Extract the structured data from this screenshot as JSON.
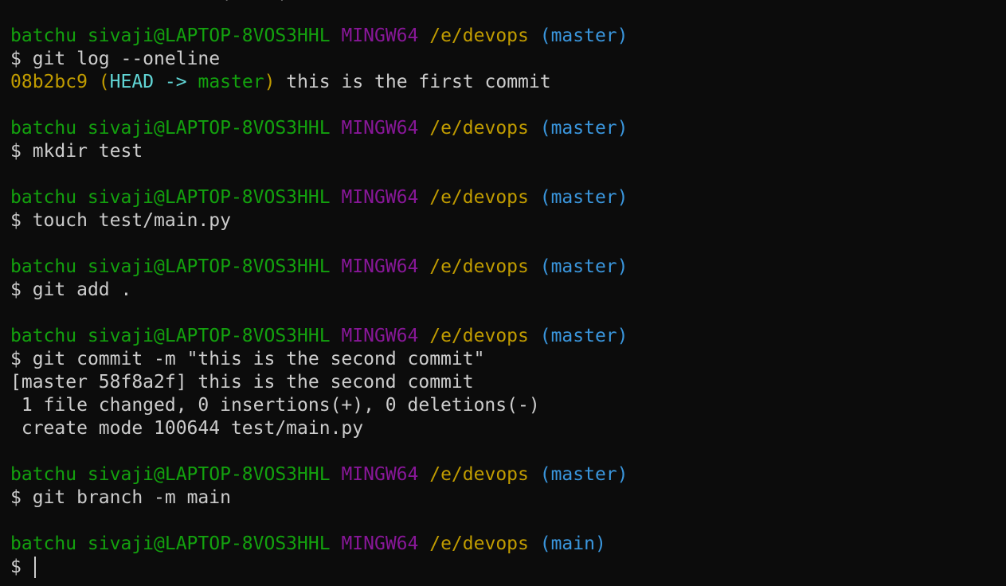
{
  "terminal": {
    "lines": [
      [
        {
          "t": "text",
          "v": "                   "
        },
        {
          "t": "text",
          "v": "ˎ    ˎ"
        }
      ],
      [],
      [
        {
          "t": "user",
          "v": "batchu sivaji@LAPTOP-8VOS3HHL"
        },
        {
          "t": "text",
          "v": " "
        },
        {
          "t": "system",
          "v": "MINGW64"
        },
        {
          "t": "text",
          "v": " "
        },
        {
          "t": "path",
          "v": "/e/devops"
        },
        {
          "t": "text",
          "v": " "
        },
        {
          "t": "branch",
          "v": "(master)"
        }
      ],
      [
        {
          "t": "dollar",
          "v": "$ "
        },
        {
          "t": "text",
          "v": "git log --oneline"
        }
      ],
      [
        {
          "t": "hash",
          "v": "08b2bc9"
        },
        {
          "t": "text",
          "v": " "
        },
        {
          "t": "paren",
          "v": "("
        },
        {
          "t": "head",
          "v": "HEAD"
        },
        {
          "t": "text",
          "v": " "
        },
        {
          "t": "arrow",
          "v": "->"
        },
        {
          "t": "text",
          "v": " "
        },
        {
          "t": "ref",
          "v": "master"
        },
        {
          "t": "paren",
          "v": ")"
        },
        {
          "t": "text",
          "v": " this is the first commit"
        }
      ],
      [],
      [
        {
          "t": "user",
          "v": "batchu sivaji@LAPTOP-8VOS3HHL"
        },
        {
          "t": "text",
          "v": " "
        },
        {
          "t": "system",
          "v": "MINGW64"
        },
        {
          "t": "text",
          "v": " "
        },
        {
          "t": "path",
          "v": "/e/devops"
        },
        {
          "t": "text",
          "v": " "
        },
        {
          "t": "branch",
          "v": "(master)"
        }
      ],
      [
        {
          "t": "dollar",
          "v": "$ "
        },
        {
          "t": "text",
          "v": "mkdir test"
        }
      ],
      [],
      [
        {
          "t": "user",
          "v": "batchu sivaji@LAPTOP-8VOS3HHL"
        },
        {
          "t": "text",
          "v": " "
        },
        {
          "t": "system",
          "v": "MINGW64"
        },
        {
          "t": "text",
          "v": " "
        },
        {
          "t": "path",
          "v": "/e/devops"
        },
        {
          "t": "text",
          "v": " "
        },
        {
          "t": "branch",
          "v": "(master)"
        }
      ],
      [
        {
          "t": "dollar",
          "v": "$ "
        },
        {
          "t": "text",
          "v": "touch test/main.py"
        }
      ],
      [],
      [
        {
          "t": "user",
          "v": "batchu sivaji@LAPTOP-8VOS3HHL"
        },
        {
          "t": "text",
          "v": " "
        },
        {
          "t": "system",
          "v": "MINGW64"
        },
        {
          "t": "text",
          "v": " "
        },
        {
          "t": "path",
          "v": "/e/devops"
        },
        {
          "t": "text",
          "v": " "
        },
        {
          "t": "branch",
          "v": "(master)"
        }
      ],
      [
        {
          "t": "dollar",
          "v": "$ "
        },
        {
          "t": "text",
          "v": "git add ."
        }
      ],
      [],
      [
        {
          "t": "user",
          "v": "batchu sivaji@LAPTOP-8VOS3HHL"
        },
        {
          "t": "text",
          "v": " "
        },
        {
          "t": "system",
          "v": "MINGW64"
        },
        {
          "t": "text",
          "v": " "
        },
        {
          "t": "path",
          "v": "/e/devops"
        },
        {
          "t": "text",
          "v": " "
        },
        {
          "t": "branch",
          "v": "(master)"
        }
      ],
      [
        {
          "t": "dollar",
          "v": "$ "
        },
        {
          "t": "text",
          "v": "git commit -m \"this is the second commit\""
        }
      ],
      [
        {
          "t": "text",
          "v": "[master 58f8a2f] this is the second commit"
        }
      ],
      [
        {
          "t": "text",
          "v": " 1 file changed, 0 insertions(+), 0 deletions(-)"
        }
      ],
      [
        {
          "t": "text",
          "v": " create mode 100644 test/main.py"
        }
      ],
      [],
      [
        {
          "t": "user",
          "v": "batchu sivaji@LAPTOP-8VOS3HHL"
        },
        {
          "t": "text",
          "v": " "
        },
        {
          "t": "system",
          "v": "MINGW64"
        },
        {
          "t": "text",
          "v": " "
        },
        {
          "t": "path",
          "v": "/e/devops"
        },
        {
          "t": "text",
          "v": " "
        },
        {
          "t": "branch",
          "v": "(master)"
        }
      ],
      [
        {
          "t": "dollar",
          "v": "$ "
        },
        {
          "t": "text",
          "v": "git branch -m main"
        }
      ],
      [],
      [
        {
          "t": "user",
          "v": "batchu sivaji@LAPTOP-8VOS3HHL"
        },
        {
          "t": "text",
          "v": " "
        },
        {
          "t": "system",
          "v": "MINGW64"
        },
        {
          "t": "text",
          "v": " "
        },
        {
          "t": "path",
          "v": "/e/devops"
        },
        {
          "t": "text",
          "v": " "
        },
        {
          "t": "branch",
          "v": "(main)"
        }
      ],
      [
        {
          "t": "dollar",
          "v": "$ "
        },
        {
          "t": "cursor",
          "v": ""
        }
      ]
    ],
    "colors": {
      "background": "#0c0c0c",
      "foreground": "#cccccc",
      "user": "#13a10e",
      "system": "#881798",
      "path": "#c19c00",
      "branch": "#3a96dd",
      "head": "#61d6d6"
    }
  }
}
